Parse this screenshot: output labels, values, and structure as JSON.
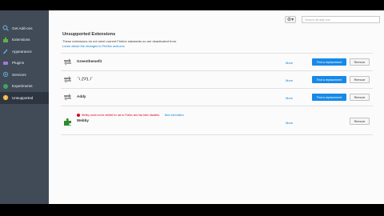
{
  "sidebar": {
    "items": [
      {
        "label": "Get Add-ons",
        "icon": "get-addons-icon",
        "color": "#6fb1e6"
      },
      {
        "label": "Extensions",
        "icon": "puzzle-icon",
        "color": "#5fb34a"
      },
      {
        "label": "Appearance",
        "icon": "brush-icon",
        "color": "#6aa8e8"
      },
      {
        "label": "Plugins",
        "icon": "plugin-icon",
        "color": "#a57ad8"
      },
      {
        "label": "Services",
        "icon": "services-icon",
        "color": "#5aa9d6"
      },
      {
        "label": "Experiments",
        "icon": "flask-icon",
        "color": "#3da55d"
      },
      {
        "label": "Unsupported",
        "icon": "warning-icon",
        "color": "#f0b13c"
      }
    ]
  },
  "toolbar": {
    "gear_label": "⚙▾",
    "search_placeholder": "Search all add-ons"
  },
  "main": {
    "title": "Unsupported Extensions",
    "description": "These extensions do not meet current Firefox standards so are deactivated from.",
    "learn_link": "Learn about the changes to Firefox add-ons"
  },
  "extensions": [
    {
      "name": "Greenthemefit",
      "more": "More",
      "find_label": "Find a replacement",
      "remove_label": "Remove",
      "icon": "arrows-icon",
      "has_find": true,
      "warning": ""
    },
    {
      "name": "¯\\_(ツ)_/¯",
      "more": "More",
      "find_label": "Find a replacement",
      "remove_label": "Remove",
      "icon": "arrows-icon",
      "has_find": true,
      "warning": ""
    },
    {
      "name": "Addy",
      "more": "More",
      "find_label": "Find a replacement",
      "remove_label": "Remove",
      "icon": "arrows-icon",
      "has_find": true,
      "warning": ""
    },
    {
      "name": "Webby",
      "more": "More",
      "find_label": "",
      "remove_label": "Remove",
      "icon": "puzzle-icon",
      "has_find": false,
      "warning": "Webby could not be verified for use in Firefox and has been disabled.",
      "warning_link": "More information"
    }
  ]
}
